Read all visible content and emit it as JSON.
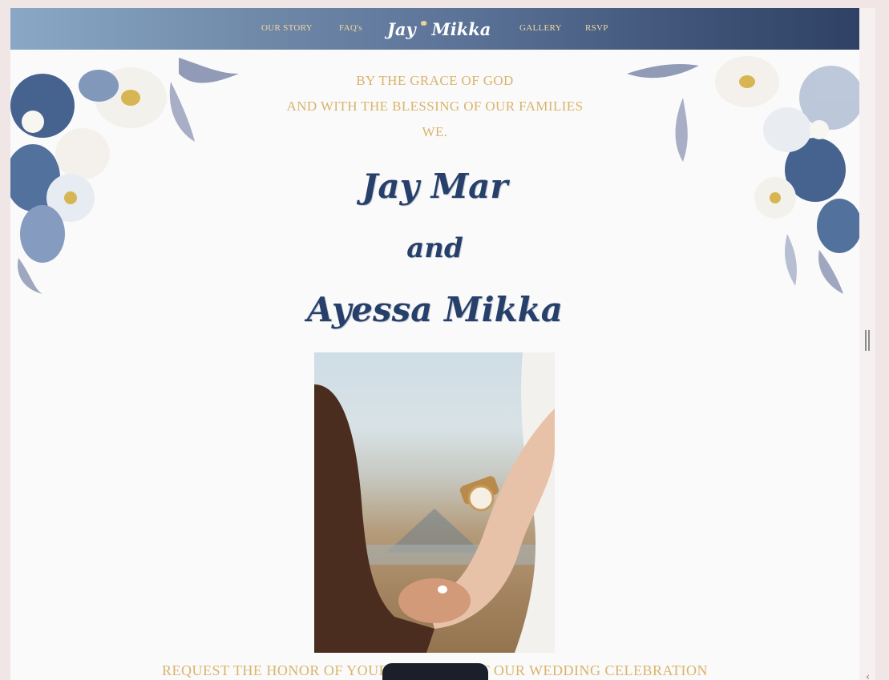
{
  "nav": {
    "links": [
      "OUR STORY",
      "FAQ's",
      "GALLERY",
      "RSVP"
    ],
    "brand_left": "Jay",
    "brand_right": "Mikka",
    "brand_icon": "rings-icon"
  },
  "intro": {
    "line1": "BY THE GRACE OF GOD",
    "line2": "AND WITH THE BLESSING OF OUR FAMILIES",
    "line3": "WE."
  },
  "names": {
    "groom": "Jay Mar",
    "and": "and",
    "bride": "Ayessa Mikka"
  },
  "photo": {
    "icon": "holding-hands-photo"
  },
  "footer_text": "REQUEST THE HONOR OF YOUR PRESENCE AT OUR WEDDING CELEBRATION",
  "colors": {
    "gold": "#d9b46b",
    "navy": "#27406a",
    "nav_gradient_start": "#8aa8c6",
    "nav_gradient_end": "#2f4266"
  }
}
